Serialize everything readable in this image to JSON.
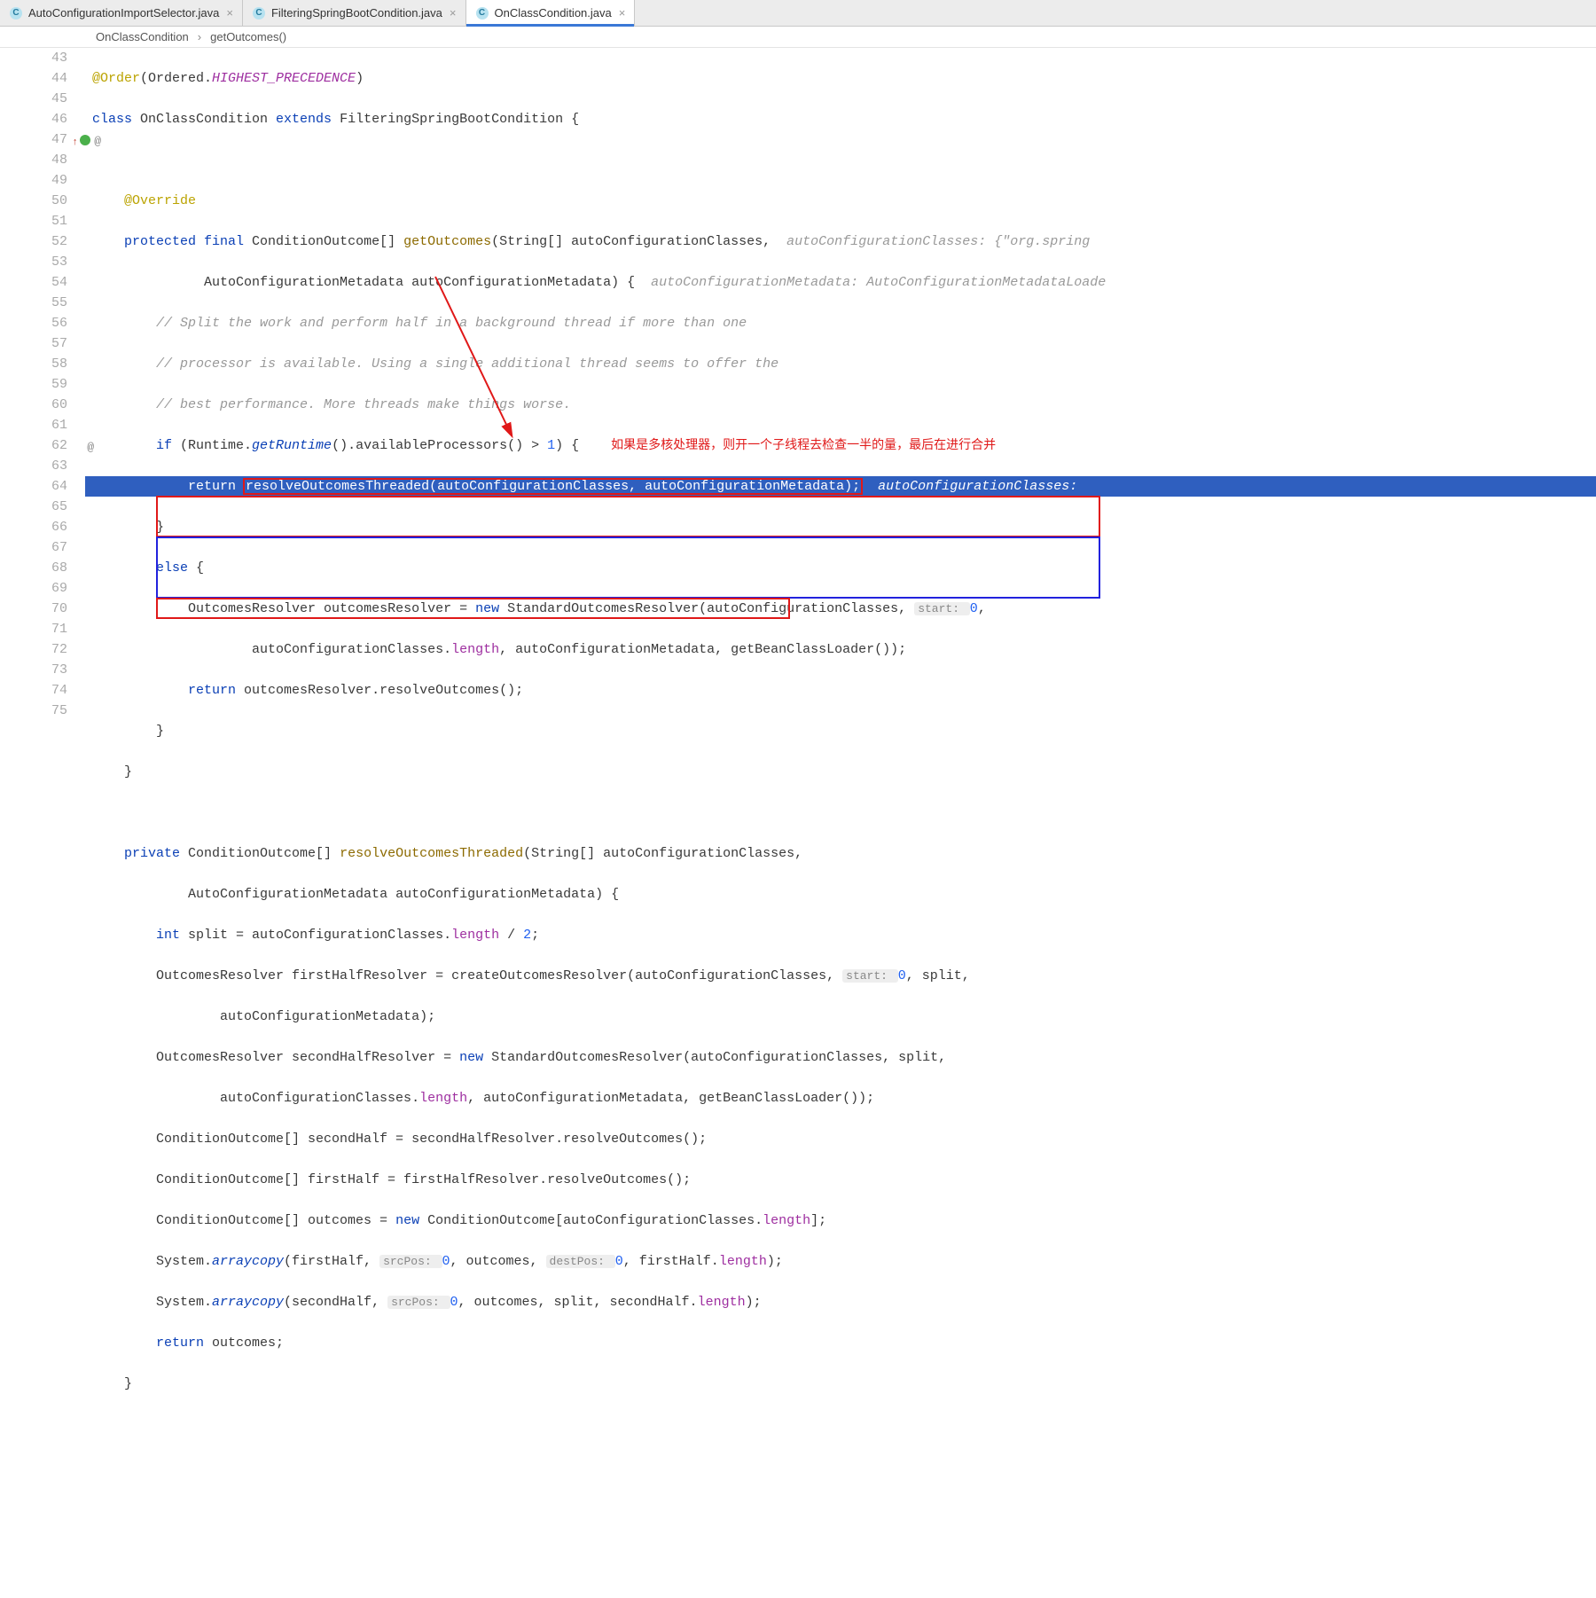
{
  "tabs": [
    {
      "label": "AutoConfigurationImportSelector.java",
      "active": false
    },
    {
      "label": "FilteringSpringBootCondition.java",
      "active": false
    },
    {
      "label": "OnClassCondition.java",
      "active": true
    }
  ],
  "breadcrumb": {
    "cls": "OnClassCondition",
    "method": "getOutcomes()"
  },
  "line_numbers": [
    "43",
    "44",
    "45",
    "46",
    "47",
    "48",
    "49",
    "50",
    "51",
    "52",
    "53",
    "54",
    "55",
    "56",
    "57",
    "58",
    "59",
    "60",
    "61",
    "62",
    "63",
    "64",
    "65",
    "66",
    "67",
    "68",
    "69",
    "70",
    "71",
    "72",
    "73",
    "74",
    "75"
  ],
  "annotation_text": "如果是多核处理器，则开一个子线程去检查一半的量，最后在进行合并",
  "code": {
    "l43": {
      "anno": "@Order",
      "p1": "(Ordered.",
      "const": "HIGHEST_PRECEDENCE",
      "p2": ")"
    },
    "l44": {
      "kw": "class ",
      "name": "OnClassCondition ",
      "ext": "extends ",
      "sup": "FilteringSpringBootCondition {"
    },
    "l46": {
      "anno": "@Override"
    },
    "l47": {
      "kw1": "protected final ",
      "type": "ConditionOutcome[] ",
      "m": "getOutcomes",
      "sig": "(String[] autoConfigurationClasses,",
      "hint": "  autoConfigurationClasses: {\"org.spring"
    },
    "l48": {
      "indent": "              ",
      "sig": "AutoConfigurationMetadata autoConfigurationMetadata) {",
      "hint": "  autoConfigurationMetadata: AutoConfigurationMetadataLoade"
    },
    "l49": "// Split the work and perform half in a background thread if more than one",
    "l50": "// processor is available. Using a single additional thread seems to offer the",
    "l51": "// best performance. More threads make things worse.",
    "l52": {
      "kw": "if ",
      "pre": "(Runtime.",
      "call": "getRuntime",
      "rest": "().availableProcessors() > ",
      "num": "1",
      "end": ") {"
    },
    "l53": {
      "kw": "return ",
      "call": "resolveOutcomesThreaded(autoConfigurationClasses, autoConfigurationMetadata);",
      "hint": "  autoConfigurationClasses: "
    },
    "l54": "}",
    "l55": {
      "kw": "else ",
      "b": "{"
    },
    "l56": {
      "pre": "OutcomesResolver outcomesResolver = ",
      "kw": "new ",
      "ctor": "StandardOutcomesResolver(autoConfigurationClasses, ",
      "inlay": "start: ",
      "num": "0",
      "end": ","
    },
    "l57": {
      "pre": "        autoConfigurationClasses.",
      "f": "length",
      "rest": ", autoConfigurationMetadata, getBeanClassLoader());"
    },
    "l58": {
      "kw": "return ",
      "rest": "outcomesResolver.resolveOutcomes();"
    },
    "l59": "}",
    "l60": "}",
    "l62": {
      "kw": "private ",
      "type": "ConditionOutcome[] ",
      "m": "resolveOutcomesThreaded",
      "sig": "(String[] autoConfigurationClasses,"
    },
    "l63": "        AutoConfigurationMetadata autoConfigurationMetadata) {",
    "l64": {
      "kw": "int ",
      "name": "split = autoConfigurationClasses.",
      "f": "length",
      "rest": " / ",
      "num": "2",
      "end": ";"
    },
    "l65": {
      "pre": "OutcomesResolver firstHalfResolver = createOutcomesResolver(autoConfigurationClasses, ",
      "inlay": "start: ",
      "num": "0",
      "rest": ", split,"
    },
    "l66": "        autoConfigurationMetadata);",
    "l67": {
      "pre": "OutcomesResolver secondHalfResolver = ",
      "kw": "new ",
      "rest": "StandardOutcomesResolver(autoConfigurationClasses, split,"
    },
    "l68": {
      "pre": "        autoConfigurationClasses.",
      "f": "length",
      "rest": ", autoConfigurationMetadata, getBeanClassLoader());"
    },
    "l69": "ConditionOutcome[] secondHalf = secondHalfResolver.resolveOutcomes();",
    "l70": "ConditionOutcome[] firstHalf = firstHalfResolver.resolveOutcomes();",
    "l71": {
      "pre": "ConditionOutcome[] outcomes = ",
      "kw": "new ",
      "rest": "ConditionOutcome[autoConfigurationClasses.",
      "f": "length",
      "end": "];"
    },
    "l72": {
      "pre": "System.",
      "m": "arraycopy",
      "p1": "(firstHalf, ",
      "in1": "srcPos: ",
      "n1": "0",
      "p2": ", outcomes, ",
      "in2": "destPos: ",
      "n2": "0",
      "p3": ", firstHalf.",
      "f": "length",
      "end": ");"
    },
    "l73": {
      "pre": "System.",
      "m": "arraycopy",
      "p1": "(secondHalf, ",
      "in1": "srcPos: ",
      "n1": "0",
      "p2": ", outcomes, split, secondHalf.",
      "f": "length",
      "end": ");"
    },
    "l74": {
      "kw": "return ",
      "rest": "outcomes;"
    },
    "l75": "}"
  }
}
